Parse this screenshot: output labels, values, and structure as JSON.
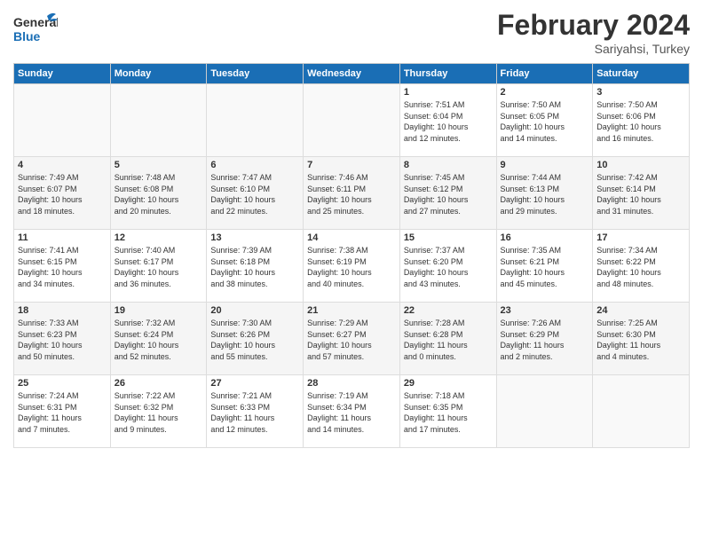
{
  "logo": {
    "text_general": "General",
    "text_blue": "Blue"
  },
  "header": {
    "month": "February 2024",
    "location": "Sariyahsi, Turkey"
  },
  "weekdays": [
    "Sunday",
    "Monday",
    "Tuesday",
    "Wednesday",
    "Thursday",
    "Friday",
    "Saturday"
  ],
  "weeks": [
    [
      {
        "day": "",
        "info": ""
      },
      {
        "day": "",
        "info": ""
      },
      {
        "day": "",
        "info": ""
      },
      {
        "day": "",
        "info": ""
      },
      {
        "day": "1",
        "info": "Sunrise: 7:51 AM\nSunset: 6:04 PM\nDaylight: 10 hours\nand 12 minutes."
      },
      {
        "day": "2",
        "info": "Sunrise: 7:50 AM\nSunset: 6:05 PM\nDaylight: 10 hours\nand 14 minutes."
      },
      {
        "day": "3",
        "info": "Sunrise: 7:50 AM\nSunset: 6:06 PM\nDaylight: 10 hours\nand 16 minutes."
      }
    ],
    [
      {
        "day": "4",
        "info": "Sunrise: 7:49 AM\nSunset: 6:07 PM\nDaylight: 10 hours\nand 18 minutes."
      },
      {
        "day": "5",
        "info": "Sunrise: 7:48 AM\nSunset: 6:08 PM\nDaylight: 10 hours\nand 20 minutes."
      },
      {
        "day": "6",
        "info": "Sunrise: 7:47 AM\nSunset: 6:10 PM\nDaylight: 10 hours\nand 22 minutes."
      },
      {
        "day": "7",
        "info": "Sunrise: 7:46 AM\nSunset: 6:11 PM\nDaylight: 10 hours\nand 25 minutes."
      },
      {
        "day": "8",
        "info": "Sunrise: 7:45 AM\nSunset: 6:12 PM\nDaylight: 10 hours\nand 27 minutes."
      },
      {
        "day": "9",
        "info": "Sunrise: 7:44 AM\nSunset: 6:13 PM\nDaylight: 10 hours\nand 29 minutes."
      },
      {
        "day": "10",
        "info": "Sunrise: 7:42 AM\nSunset: 6:14 PM\nDaylight: 10 hours\nand 31 minutes."
      }
    ],
    [
      {
        "day": "11",
        "info": "Sunrise: 7:41 AM\nSunset: 6:15 PM\nDaylight: 10 hours\nand 34 minutes."
      },
      {
        "day": "12",
        "info": "Sunrise: 7:40 AM\nSunset: 6:17 PM\nDaylight: 10 hours\nand 36 minutes."
      },
      {
        "day": "13",
        "info": "Sunrise: 7:39 AM\nSunset: 6:18 PM\nDaylight: 10 hours\nand 38 minutes."
      },
      {
        "day": "14",
        "info": "Sunrise: 7:38 AM\nSunset: 6:19 PM\nDaylight: 10 hours\nand 40 minutes."
      },
      {
        "day": "15",
        "info": "Sunrise: 7:37 AM\nSunset: 6:20 PM\nDaylight: 10 hours\nand 43 minutes."
      },
      {
        "day": "16",
        "info": "Sunrise: 7:35 AM\nSunset: 6:21 PM\nDaylight: 10 hours\nand 45 minutes."
      },
      {
        "day": "17",
        "info": "Sunrise: 7:34 AM\nSunset: 6:22 PM\nDaylight: 10 hours\nand 48 minutes."
      }
    ],
    [
      {
        "day": "18",
        "info": "Sunrise: 7:33 AM\nSunset: 6:23 PM\nDaylight: 10 hours\nand 50 minutes."
      },
      {
        "day": "19",
        "info": "Sunrise: 7:32 AM\nSunset: 6:24 PM\nDaylight: 10 hours\nand 52 minutes."
      },
      {
        "day": "20",
        "info": "Sunrise: 7:30 AM\nSunset: 6:26 PM\nDaylight: 10 hours\nand 55 minutes."
      },
      {
        "day": "21",
        "info": "Sunrise: 7:29 AM\nSunset: 6:27 PM\nDaylight: 10 hours\nand 57 minutes."
      },
      {
        "day": "22",
        "info": "Sunrise: 7:28 AM\nSunset: 6:28 PM\nDaylight: 11 hours\nand 0 minutes."
      },
      {
        "day": "23",
        "info": "Sunrise: 7:26 AM\nSunset: 6:29 PM\nDaylight: 11 hours\nand 2 minutes."
      },
      {
        "day": "24",
        "info": "Sunrise: 7:25 AM\nSunset: 6:30 PM\nDaylight: 11 hours\nand 4 minutes."
      }
    ],
    [
      {
        "day": "25",
        "info": "Sunrise: 7:24 AM\nSunset: 6:31 PM\nDaylight: 11 hours\nand 7 minutes."
      },
      {
        "day": "26",
        "info": "Sunrise: 7:22 AM\nSunset: 6:32 PM\nDaylight: 11 hours\nand 9 minutes."
      },
      {
        "day": "27",
        "info": "Sunrise: 7:21 AM\nSunset: 6:33 PM\nDaylight: 11 hours\nand 12 minutes."
      },
      {
        "day": "28",
        "info": "Sunrise: 7:19 AM\nSunset: 6:34 PM\nDaylight: 11 hours\nand 14 minutes."
      },
      {
        "day": "29",
        "info": "Sunrise: 7:18 AM\nSunset: 6:35 PM\nDaylight: 11 hours\nand 17 minutes."
      },
      {
        "day": "",
        "info": ""
      },
      {
        "day": "",
        "info": ""
      }
    ]
  ]
}
